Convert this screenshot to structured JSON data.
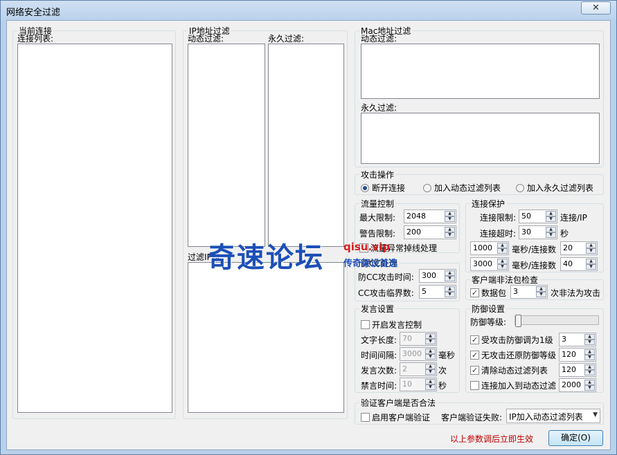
{
  "window": {
    "title": "网络安全过滤",
    "close": "✕"
  },
  "current": {
    "title": "当前连接",
    "list_label": "连接列表:"
  },
  "ip": {
    "title": "IP地址过滤",
    "dynamic": "动态过滤:",
    "permanent": "永久过滤:",
    "segment": "过滤IP段:"
  },
  "mac": {
    "title": "Mac地址过滤",
    "dynamic": "动态过滤:",
    "permanent": "永久过滤:"
  },
  "attack": {
    "title": "攻击操作",
    "options": [
      "断开连接",
      "加入动态过滤列表",
      "加入永久过滤列表"
    ],
    "selected": 0
  },
  "flow": {
    "title": "流量控制",
    "max_label": "最大限制:",
    "max_value": "2048",
    "warn_label": "警告限制:",
    "warn_value": "200",
    "offline_label": "流量异常掉线处理"
  },
  "conn": {
    "title": "连接保护",
    "limit_label": "连接限制:",
    "limit_value": "50",
    "limit_unit": "连接/IP",
    "timeout_label": "连接超时:",
    "timeout_value": "30",
    "timeout_unit": "秒",
    "ms1_value": "1000",
    "ms1_unit": "毫秒/连接数",
    "ms1_count": "20",
    "ms2_value": "3000",
    "ms2_unit": "毫秒/连接数",
    "ms2_count": "40"
  },
  "cc": {
    "title": "防CC处理",
    "time_label": "防CC攻击时间:",
    "time_value": "300",
    "thresh_label": "CC攻击临界数:",
    "thresh_value": "5"
  },
  "illegal": {
    "title": "客户端非法包检查",
    "packet_label": "数据包",
    "packet_value": "3",
    "packet_suffix": "次非法为攻击"
  },
  "speech": {
    "title": "发言设置",
    "enable_label": "开启发言控制",
    "len_label": "文字长度:",
    "len_value": "70",
    "interval_label": "时间间隔:",
    "interval_value": "3000",
    "interval_unit": "毫秒",
    "count_label": "发言次数:",
    "count_value": "2",
    "count_unit": "次",
    "ban_label": "禁言时间:",
    "ban_value": "10",
    "ban_unit": "秒"
  },
  "defense": {
    "title": "防御设置",
    "level_label": "防御等级:",
    "level_fraction": 0,
    "opt1_label": "受攻击防御调为1级",
    "opt1_value": "3",
    "opt2_label": "无攻击还原防御等级",
    "opt2_value": "120",
    "opt3_label": "清除动态过滤列表",
    "opt3_value": "120",
    "opt4_label": "连接加入到动态过滤",
    "opt4_value": "2000"
  },
  "verify": {
    "title": "验证客户端是否合法",
    "enable_label": "启用客户端验证",
    "fail_label": "客户端验证失败:",
    "fail_value": "IP加入动态过滤列表"
  },
  "footer": {
    "note": "以上参数调后立即生效",
    "ok_label": "确定(O)"
  },
  "watermark": {
    "main": "奇速论坛",
    "url": "qisu.vip",
    "sub": "传奇架设首选"
  }
}
